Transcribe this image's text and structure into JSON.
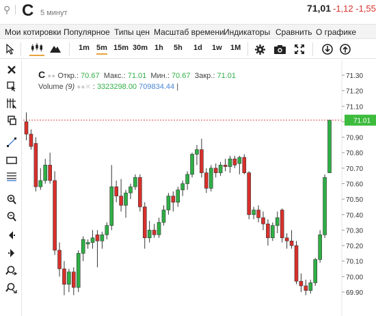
{
  "header": {
    "search_icon": "search-icon",
    "ticker": "C",
    "interval": "5 минут",
    "price": "71,01",
    "change": "-1,12 -1,55"
  },
  "menu": [
    "Мои котировки",
    "Популярное",
    "Типы цен",
    "Масштаб времени",
    "Индикаторы",
    "Сравнить",
    "О графике"
  ],
  "toolbar": {
    "timeframes": [
      "1m",
      "5m",
      "15m",
      "30m",
      "1h",
      "5h",
      "1d",
      "1w",
      "1M"
    ],
    "active_timeframe": "5m",
    "icons": [
      "cursor-icon",
      "candles-icon",
      "mountain-icon",
      "gear-icon",
      "camera-icon",
      "fullscreen-icon",
      "download-icon",
      "upload-icon"
    ]
  },
  "left_tools": [
    "close-icon",
    "cursor-cross-icon",
    "crosshair-icon",
    "copy-icon",
    "line-icon",
    "rectangle-icon",
    "fib-icon",
    "zoom-in-icon",
    "zoom-out-icon",
    "scroll-left-icon",
    "scroll-right-icon",
    "magnet-icon",
    "magnifier-icon"
  ],
  "legend": {
    "symbol": "C",
    "open_label": "Откр.:",
    "open": "70.67",
    "high_label": "Макс.:",
    "high": "71.01",
    "low_label": "Мин.:",
    "low": "70.67",
    "close_label": "Закр.:",
    "close": "71.01",
    "volume_label": "Volume",
    "volume_period": "(9)",
    "volume_value": "3323298.00",
    "volume_ma": "709834.44"
  },
  "colors": {
    "up": "#2eaf45",
    "down": "#d9302b",
    "price_label_bg": "#3dbb3d"
  },
  "chart_data": {
    "type": "candlestick",
    "price_label": "71.01",
    "y_ticks": [
      "71.30",
      "71.20",
      "71.10",
      "71.00",
      "70.90",
      "70.80",
      "70.70",
      "70.60",
      "70.50",
      "70.40",
      "70.30",
      "70.20",
      "70.10",
      "70.00",
      "69.90"
    ],
    "ylim": [
      69.88,
      71.32
    ],
    "candles": [
      {
        "o": 71.0,
        "h": 71.06,
        "l": 70.88,
        "c": 70.92
      },
      {
        "o": 70.92,
        "h": 70.95,
        "l": 70.82,
        "c": 70.84
      },
      {
        "o": 70.86,
        "h": 70.9,
        "l": 70.55,
        "c": 70.58
      },
      {
        "o": 70.58,
        "h": 70.7,
        "l": 70.56,
        "c": 70.62
      },
      {
        "o": 70.62,
        "h": 70.76,
        "l": 70.6,
        "c": 70.72
      },
      {
        "o": 70.72,
        "h": 70.8,
        "l": 70.6,
        "c": 70.62
      },
      {
        "o": 70.62,
        "h": 70.68,
        "l": 70.14,
        "c": 70.17
      },
      {
        "o": 70.17,
        "h": 70.22,
        "l": 70.0,
        "c": 70.05
      },
      {
        "o": 70.05,
        "h": 70.1,
        "l": 69.88,
        "c": 69.95
      },
      {
        "o": 69.95,
        "h": 70.05,
        "l": 69.9,
        "c": 70.03
      },
      {
        "o": 70.03,
        "h": 70.06,
        "l": 69.88,
        "c": 69.93
      },
      {
        "o": 69.93,
        "h": 70.17,
        "l": 69.9,
        "c": 70.15
      },
      {
        "o": 70.15,
        "h": 70.26,
        "l": 70.1,
        "c": 70.24
      },
      {
        "o": 70.21,
        "h": 70.24,
        "l": 70.18,
        "c": 70.22
      },
      {
        "o": 70.22,
        "h": 70.3,
        "l": 70.18,
        "c": 70.25
      },
      {
        "o": 70.27,
        "h": 70.3,
        "l": 70.06,
        "c": 70.23
      },
      {
        "o": 70.23,
        "h": 70.29,
        "l": 70.18,
        "c": 70.27
      },
      {
        "o": 70.27,
        "h": 70.35,
        "l": 70.24,
        "c": 70.33
      },
      {
        "o": 70.33,
        "h": 70.72,
        "l": 70.3,
        "c": 70.58
      },
      {
        "o": 70.58,
        "h": 70.62,
        "l": 70.48,
        "c": 70.52
      },
      {
        "o": 70.52,
        "h": 70.63,
        "l": 70.42,
        "c": 70.46
      },
      {
        "o": 70.46,
        "h": 70.56,
        "l": 70.38,
        "c": 70.54
      },
      {
        "o": 70.54,
        "h": 70.6,
        "l": 70.5,
        "c": 70.58
      },
      {
        "o": 70.58,
        "h": 70.66,
        "l": 70.56,
        "c": 70.64
      },
      {
        "o": 70.64,
        "h": 70.66,
        "l": 70.42,
        "c": 70.45
      },
      {
        "o": 70.45,
        "h": 70.48,
        "l": 70.18,
        "c": 70.25
      },
      {
        "o": 70.25,
        "h": 70.36,
        "l": 70.22,
        "c": 70.3
      },
      {
        "o": 70.3,
        "h": 70.34,
        "l": 70.25,
        "c": 70.27
      },
      {
        "o": 70.27,
        "h": 70.38,
        "l": 70.25,
        "c": 70.35
      },
      {
        "o": 70.35,
        "h": 70.46,
        "l": 70.33,
        "c": 70.43
      },
      {
        "o": 70.43,
        "h": 70.54,
        "l": 70.4,
        "c": 70.52
      },
      {
        "o": 70.52,
        "h": 70.55,
        "l": 70.42,
        "c": 70.48
      },
      {
        "o": 70.48,
        "h": 70.58,
        "l": 70.45,
        "c": 70.56
      },
      {
        "o": 70.56,
        "h": 70.62,
        "l": 70.52,
        "c": 70.6
      },
      {
        "o": 70.6,
        "h": 70.68,
        "l": 70.56,
        "c": 70.66
      },
      {
        "o": 70.66,
        "h": 70.8,
        "l": 70.64,
        "c": 70.79
      },
      {
        "o": 70.79,
        "h": 70.85,
        "l": 70.72,
        "c": 70.82
      },
      {
        "o": 70.82,
        "h": 70.89,
        "l": 70.64,
        "c": 70.67
      },
      {
        "o": 70.67,
        "h": 70.7,
        "l": 70.54,
        "c": 70.57
      },
      {
        "o": 70.57,
        "h": 70.72,
        "l": 70.55,
        "c": 70.7
      },
      {
        "o": 70.7,
        "h": 70.73,
        "l": 70.64,
        "c": 70.67
      },
      {
        "o": 70.67,
        "h": 70.74,
        "l": 70.65,
        "c": 70.72
      },
      {
        "o": 70.72,
        "h": 70.76,
        "l": 70.68,
        "c": 70.71
      },
      {
        "o": 70.71,
        "h": 70.78,
        "l": 70.67,
        "c": 70.76
      },
      {
        "o": 70.76,
        "h": 70.78,
        "l": 70.7,
        "c": 70.72
      },
      {
        "o": 70.73,
        "h": 70.78,
        "l": 70.66,
        "c": 70.77
      },
      {
        "o": 70.77,
        "h": 70.79,
        "l": 70.66,
        "c": 70.67
      },
      {
        "o": 70.67,
        "h": 70.68,
        "l": 70.37,
        "c": 70.4
      },
      {
        "o": 70.4,
        "h": 70.45,
        "l": 70.37,
        "c": 70.43
      },
      {
        "o": 70.43,
        "h": 70.46,
        "l": 70.35,
        "c": 70.38
      },
      {
        "o": 70.38,
        "h": 70.42,
        "l": 70.3,
        "c": 70.34
      },
      {
        "o": 70.34,
        "h": 70.37,
        "l": 70.2,
        "c": 70.25
      },
      {
        "o": 70.25,
        "h": 70.35,
        "l": 70.23,
        "c": 70.33
      },
      {
        "o": 70.33,
        "h": 70.42,
        "l": 70.28,
        "c": 70.38
      },
      {
        "o": 70.43,
        "h": 70.44,
        "l": 70.22,
        "c": 70.25
      },
      {
        "o": 70.25,
        "h": 70.28,
        "l": 70.18,
        "c": 70.23
      },
      {
        "o": 70.23,
        "h": 70.3,
        "l": 70.18,
        "c": 70.2
      },
      {
        "o": 70.2,
        "h": 70.23,
        "l": 69.95,
        "c": 69.97
      },
      {
        "o": 69.97,
        "h": 70.02,
        "l": 69.9,
        "c": 69.94
      },
      {
        "o": 69.94,
        "h": 69.98,
        "l": 69.88,
        "c": 69.91
      },
      {
        "o": 69.91,
        "h": 69.98,
        "l": 69.89,
        "c": 69.96
      },
      {
        "o": 69.96,
        "h": 70.12,
        "l": 69.94,
        "c": 70.11
      },
      {
        "o": 70.11,
        "h": 70.3,
        "l": 70.09,
        "c": 70.27
      },
      {
        "o": 70.27,
        "h": 70.66,
        "l": 70.25,
        "c": 70.64
      },
      {
        "o": 70.67,
        "h": 71.01,
        "l": 70.67,
        "c": 71.01
      }
    ]
  }
}
